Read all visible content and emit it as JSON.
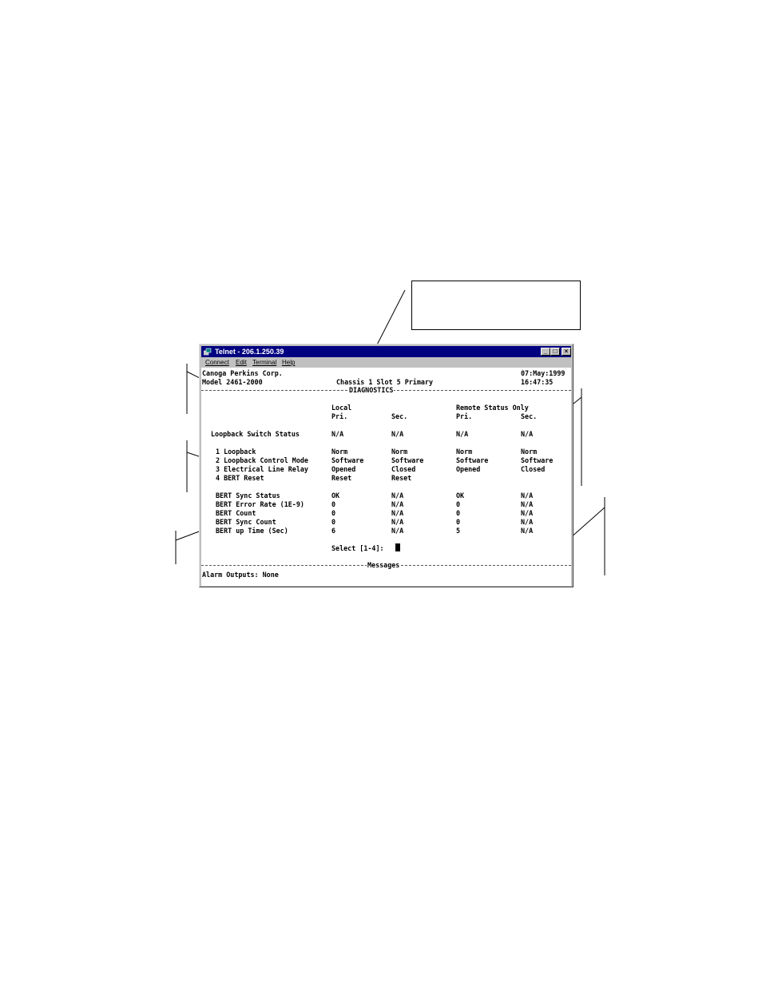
{
  "window": {
    "title": "Telnet - 206.1.250.39",
    "buttons": {
      "minimize": "_",
      "maximize": "□",
      "close": "×"
    }
  },
  "menu": [
    "Connect",
    "Edit",
    "Terminal",
    "Help"
  ],
  "screen": {
    "company": "Canoga Perkins Corp.",
    "model": "Model 2461-2000",
    "chassis": "Chassis 1 Slot 5 Primary",
    "date": "07:May:1999",
    "time": "16:47:35",
    "section_title": "DIAGNOSTICS",
    "column_groups": {
      "local": "Local",
      "remote": "Remote Status Only"
    },
    "column_headers": [
      "Pri.",
      "Sec.",
      "Pri.",
      "Sec."
    ],
    "switch_status": {
      "label": "Loopback Switch Status",
      "values": [
        "N/A",
        "N/A",
        "N/A",
        "N/A"
      ]
    },
    "options": [
      {
        "label": "1 Loopback",
        "values": [
          "Norm",
          "Norm",
          "Norm",
          "Norm"
        ]
      },
      {
        "label": "2 Loopback Control Mode",
        "values": [
          "Software",
          "Software",
          "Software",
          "Software"
        ]
      },
      {
        "label": "3 Electrical Line Relay",
        "values": [
          "Opened",
          "Closed",
          "Opened",
          "Closed"
        ]
      },
      {
        "label": "4 BERT Reset",
        "values": [
          "Reset",
          "Reset",
          "",
          ""
        ]
      }
    ],
    "bert": [
      {
        "label": "BERT Sync Status",
        "values": [
          "OK",
          "N/A",
          "OK",
          "N/A"
        ]
      },
      {
        "label": "BERT Error Rate (1E-9)",
        "values": [
          "0",
          "N/A",
          "0",
          "N/A"
        ]
      },
      {
        "label": "BERT Count",
        "values": [
          "0",
          "N/A",
          "0",
          "N/A"
        ]
      },
      {
        "label": "BERT Sync Count",
        "values": [
          "0",
          "N/A",
          "0",
          "N/A"
        ]
      },
      {
        "label": "BERT up Time (Sec)",
        "values": [
          "6",
          "N/A",
          "5",
          "N/A"
        ]
      }
    ],
    "prompt": "Select [1-4]:",
    "messages_title": "Messages",
    "alarm": "Alarm Outputs: None"
  }
}
